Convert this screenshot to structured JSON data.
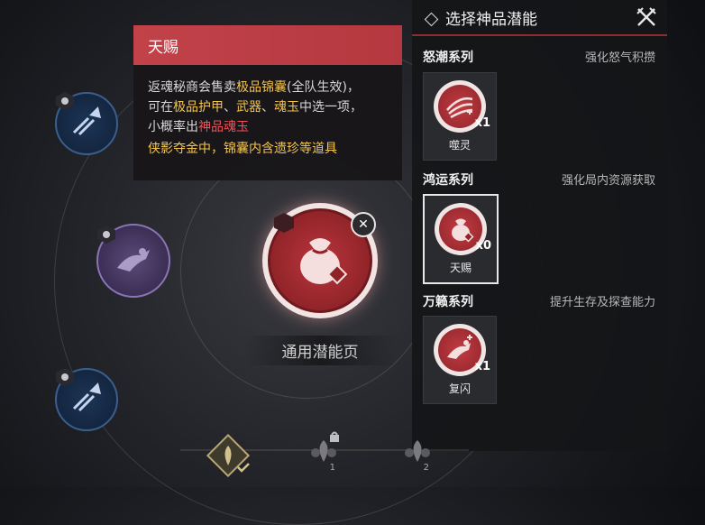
{
  "tooltip": {
    "title": "天赐",
    "line1_a": "返魂秘商会售卖",
    "line1_b": "极品锦囊",
    "line1_c": "(全队生效)，",
    "line2_a": "可在",
    "line2_b": "极品护甲",
    "line2_c": "、",
    "line2_d": "武器",
    "line2_e": "、",
    "line2_f": "魂玉",
    "line2_g": "中选一项，",
    "line3_a": "小概率出",
    "line3_b": "神品魂玉",
    "note": "侠影夺金中，锦囊内含遗珍等道具"
  },
  "center": {
    "label": "通用潜能页",
    "icon": "lucky-bag-icon"
  },
  "panel": {
    "title": "选择神品潜能",
    "sections": [
      {
        "name": "怒潮系列",
        "desc": "强化怒气积攒",
        "card": {
          "label": "噬灵",
          "count": "x1",
          "icon": "claw-strike-icon"
        }
      },
      {
        "name": "鸿运系列",
        "desc": "强化局内资源获取",
        "card": {
          "label": "天赐",
          "count": "x0",
          "icon": "lucky-bag-icon"
        }
      },
      {
        "name": "万籁系列",
        "desc": "提升生存及探查能力",
        "card": {
          "label": "复闪",
          "count": "x1",
          "icon": "dash-icon"
        }
      }
    ]
  },
  "bottom": {
    "slot1_num": "1",
    "slot2_num": "2"
  },
  "colors": {
    "accent_red": "#c2424a",
    "gold": "#f2c34c",
    "hot_red": "#f0525a"
  }
}
